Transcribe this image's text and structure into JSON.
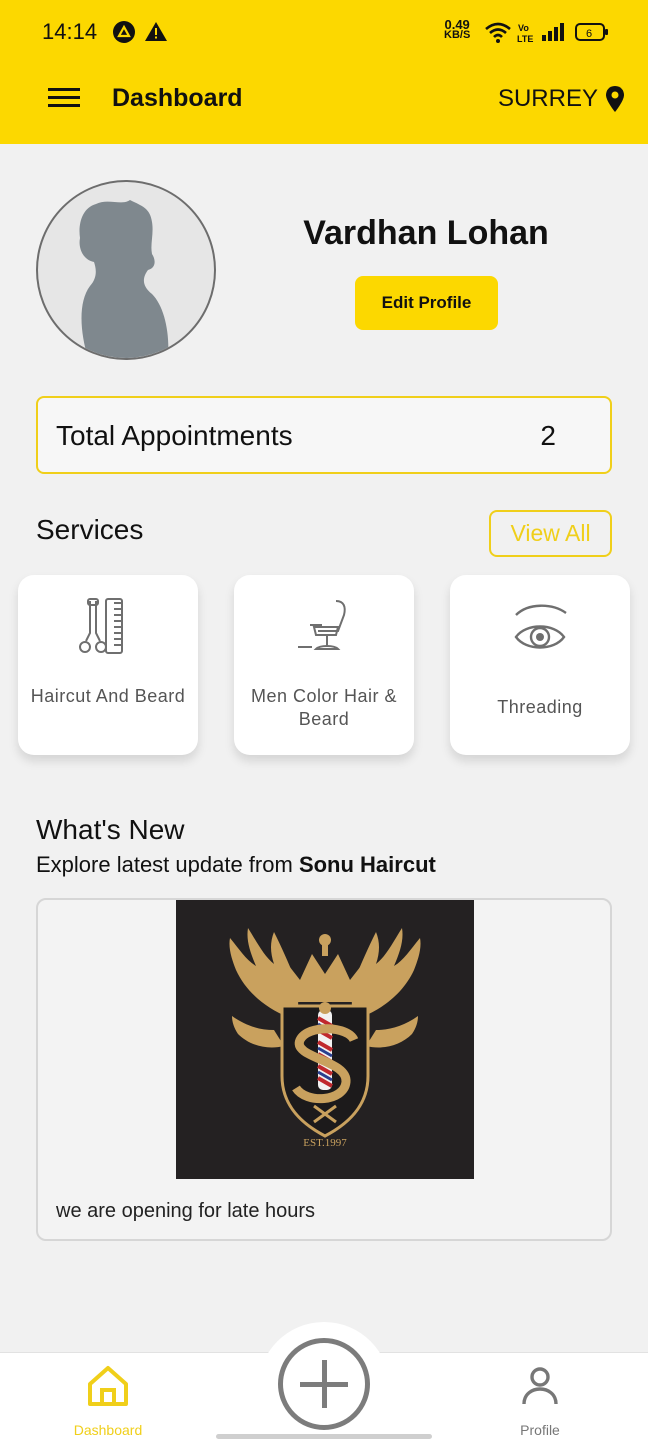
{
  "status_bar": {
    "time": "14:14",
    "net_speed_value": "0.49",
    "net_speed_unit": "KB/S",
    "battery": "6"
  },
  "app_bar": {
    "title": "Dashboard",
    "location": "SURREY"
  },
  "profile": {
    "name": "Vardhan Lohan",
    "edit_label": "Edit Profile"
  },
  "appointments": {
    "label": "Total Appointments",
    "count": "2"
  },
  "services": {
    "title": "Services",
    "view_all_label": "View All",
    "items": [
      {
        "label": "Haircut And Beard",
        "icon": "scissors-comb-icon"
      },
      {
        "label": "Men Color Hair & Beard",
        "icon": "barber-chair-icon"
      },
      {
        "label": "Threading",
        "icon": "eye-icon"
      }
    ]
  },
  "whats_new": {
    "title": "What's New",
    "subtitle_prefix": "Explore latest update from",
    "shop_name": "Sonu Haircut",
    "post": {
      "logo_text": "EST.1997",
      "caption": "we are opening for late hours"
    }
  },
  "bottom_nav": {
    "items": [
      {
        "label": "Dashboard",
        "icon": "home-icon",
        "active": true
      },
      {
        "label": "Profile",
        "icon": "person-icon",
        "active": false
      }
    ],
    "fab_icon": "plus-icon"
  },
  "colors": {
    "accent": "#fcd800",
    "accent_border": "#f0cf1a",
    "background": "#f1f1f1",
    "logo_gold": "#c9a15e"
  }
}
